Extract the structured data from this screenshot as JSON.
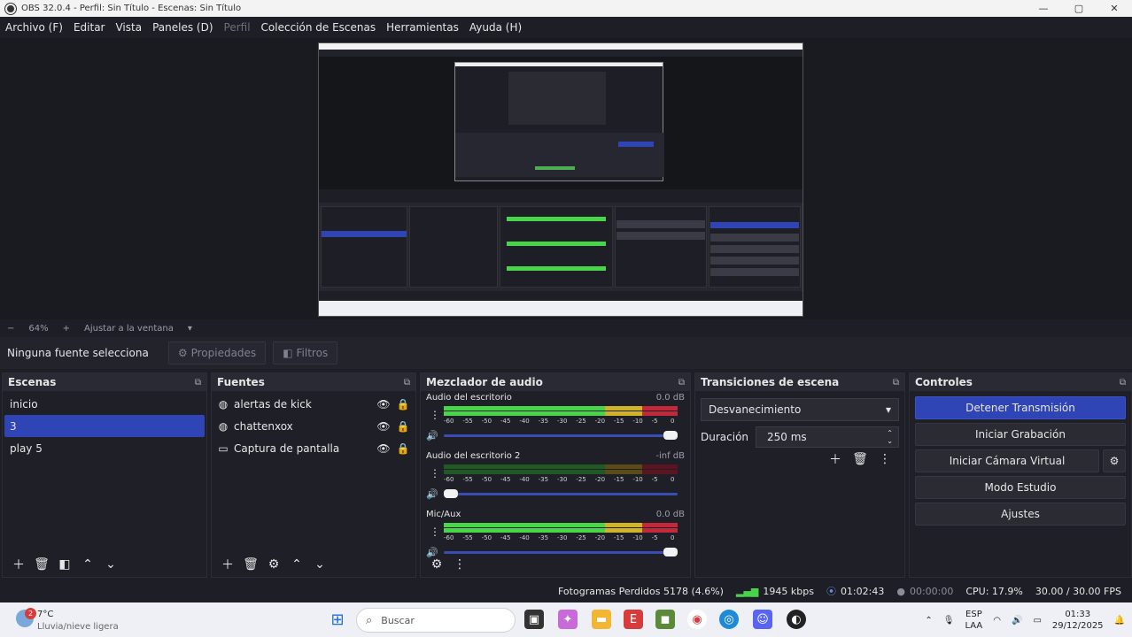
{
  "window": {
    "title": "OBS 32.0.4 - Perfil: Sin Título - Escenas: Sin Título",
    "minimize": "—",
    "maximize": "▢",
    "close": "✕"
  },
  "menu": [
    "Archivo (F)",
    "Editar",
    "Vista",
    "Paneles (D)",
    "Perfil",
    "Colección de Escenas",
    "Herramientas",
    "Ayuda (H)"
  ],
  "zoom": {
    "minus": "−",
    "value": "64%",
    "plus": "+",
    "fit_label": "Ajustar a la ventana",
    "dropdown": "▾"
  },
  "source_toolbar": {
    "selected": "Ninguna fuente selecciona",
    "properties": "Propiedades",
    "filters": "Filtros"
  },
  "scenes": {
    "title": "Escenas",
    "items": [
      "inicio",
      "3",
      "play 5"
    ],
    "selected_index": 1
  },
  "sources": {
    "title": "Fuentes",
    "items": [
      {
        "name": "alertas de kick",
        "icon": "browser-icon"
      },
      {
        "name": "chattenxox",
        "icon": "browser-icon"
      },
      {
        "name": "Captura de pantalla",
        "icon": "monitor-icon"
      }
    ]
  },
  "mixer": {
    "title": "Mezclador de audio",
    "ticks": [
      "-60",
      "-55",
      "-50",
      "-45",
      "-40",
      "-35",
      "-30",
      "-25",
      "-20",
      "-15",
      "-10",
      "-5",
      "0"
    ],
    "channels": [
      {
        "name": "Audio del escritorio",
        "db": "0.0 dB",
        "level": 1.0,
        "volume": 1.0
      },
      {
        "name": "Audio del escritorio 2",
        "db": "-inf dB",
        "level": 0.0,
        "volume": 0.0
      },
      {
        "name": "Mic/Aux",
        "db": "0.0 dB",
        "level": 1.0,
        "volume": 1.0
      }
    ]
  },
  "transitions": {
    "title": "Transiciones de escena",
    "selected": "Desvanecimiento",
    "duration_label": "Duración",
    "duration_value": "250 ms"
  },
  "controls": {
    "title": "Controles",
    "buttons": [
      "Detener Transmisión",
      "Iniciar Grabación",
      "Iniciar Cámara Virtual",
      "Modo Estudio",
      "Ajustes"
    ]
  },
  "status": {
    "dropped": "Fotogramas Perdidos 5178 (4.6%)",
    "bitrate": "1945 kbps",
    "stream_time": "01:02:43",
    "rec_time": "00:00:00",
    "cpu": "CPU: 17.9%",
    "fps": "30.00 / 30.00 FPS"
  },
  "taskbar": {
    "weather_temp": "7°C",
    "weather_badge": "2",
    "weather_condition": "Lluvia/nieve ligera",
    "search_placeholder": "Buscar",
    "lang": "ESP",
    "lang2": "LAA",
    "time": "01:33",
    "date": "29/12/2025"
  },
  "colors": {
    "accent": "#2f45b5",
    "meter_green": "#49d54a",
    "meter_yellow": "#d1b32a",
    "meter_red": "#c22a3b"
  }
}
